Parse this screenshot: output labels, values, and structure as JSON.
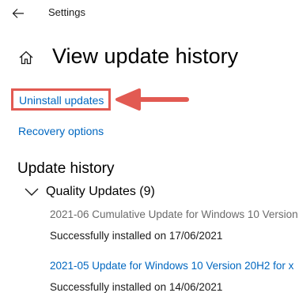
{
  "window": {
    "app_title": "Settings",
    "back_icon": "back-arrow-icon"
  },
  "page": {
    "home_icon": "home-icon",
    "title": "View update history"
  },
  "links": {
    "uninstall_updates": "Uninstall updates",
    "recovery_options": "Recovery options"
  },
  "annotation": {
    "color": "#e25a52",
    "target": "uninstall-updates-link"
  },
  "history": {
    "heading": "Update history",
    "group": {
      "label": "Quality Updates (9)",
      "expanded": true
    },
    "items": [
      {
        "title": "2021-06 Cumulative Update for Windows 10 Version",
        "status": "Successfully installed on 17/06/2021"
      },
      {
        "title": "2021-05 Update for Windows 10 Version 20H2 for x",
        "status": "Successfully installed on 14/06/2021"
      }
    ]
  },
  "colors": {
    "accent_link": "#0067c0",
    "muted_text": "#6b6b6b"
  }
}
